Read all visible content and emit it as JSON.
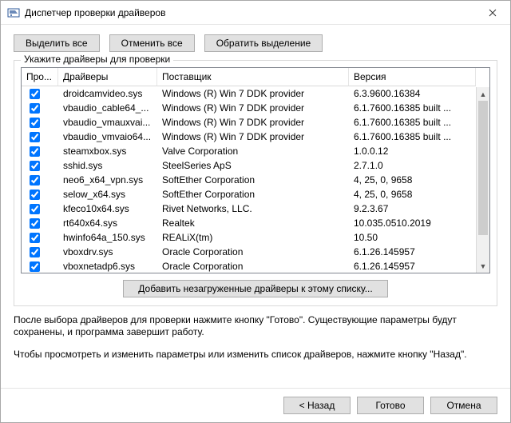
{
  "window": {
    "title": "Диспетчер проверки драйверов"
  },
  "toolbar": {
    "select_all": "Выделить все",
    "deselect_all": "Отменить все",
    "invert": "Обратить выделение"
  },
  "group": {
    "label": "Укажите драйверы для проверки"
  },
  "columns": {
    "check": "Про...",
    "driver": "Драйверы",
    "vendor": "Поставщик",
    "version": "Версия"
  },
  "rows": [
    {
      "checked": true,
      "driver": "droidcamvideo.sys",
      "vendor": "Windows (R) Win 7 DDK provider",
      "version": "6.3.9600.16384"
    },
    {
      "checked": true,
      "driver": "vbaudio_cable64_...",
      "vendor": "Windows (R) Win 7 DDK provider",
      "version": "6.1.7600.16385 built ..."
    },
    {
      "checked": true,
      "driver": "vbaudio_vmauxvai...",
      "vendor": "Windows (R) Win 7 DDK provider",
      "version": "6.1.7600.16385 built ..."
    },
    {
      "checked": true,
      "driver": "vbaudio_vmvaio64...",
      "vendor": "Windows (R) Win 7 DDK provider",
      "version": "6.1.7600.16385 built ..."
    },
    {
      "checked": true,
      "driver": "steamxbox.sys",
      "vendor": "Valve Corporation",
      "version": "1.0.0.12"
    },
    {
      "checked": true,
      "driver": "sshid.sys",
      "vendor": "SteelSeries ApS",
      "version": "2.7.1.0"
    },
    {
      "checked": true,
      "driver": "neo6_x64_vpn.sys",
      "vendor": "SoftEther Corporation",
      "version": "4, 25, 0, 9658"
    },
    {
      "checked": true,
      "driver": "selow_x64.sys",
      "vendor": "SoftEther Corporation",
      "version": "4, 25, 0, 9658"
    },
    {
      "checked": true,
      "driver": "kfeco10x64.sys",
      "vendor": "Rivet Networks, LLC.",
      "version": "9.2.3.67"
    },
    {
      "checked": true,
      "driver": "rt640x64.sys",
      "vendor": "Realtek",
      "version": "10.035.0510.2019"
    },
    {
      "checked": true,
      "driver": "hwinfo64a_150.sys",
      "vendor": "REALiX(tm)",
      "version": "10.50"
    },
    {
      "checked": true,
      "driver": "vboxdrv.sys",
      "vendor": "Oracle Corporation",
      "version": "6.1.26.145957"
    },
    {
      "checked": true,
      "driver": "vboxnetadp6.sys",
      "vendor": "Oracle Corporation",
      "version": "6.1.26.145957"
    }
  ],
  "add_button": "Добавить незагруженные драйверы к этому списку...",
  "info": {
    "p1": "После выбора драйверов для проверки нажмите кнопку \"Готово\". Существующие параметры будут сохранены, и программа завершит работу.",
    "p2": "Чтобы просмотреть и изменить параметры или изменить список драйверов, нажмите кнопку \"Назад\"."
  },
  "footer": {
    "back": "< Назад",
    "finish": "Готово",
    "cancel": "Отмена"
  }
}
